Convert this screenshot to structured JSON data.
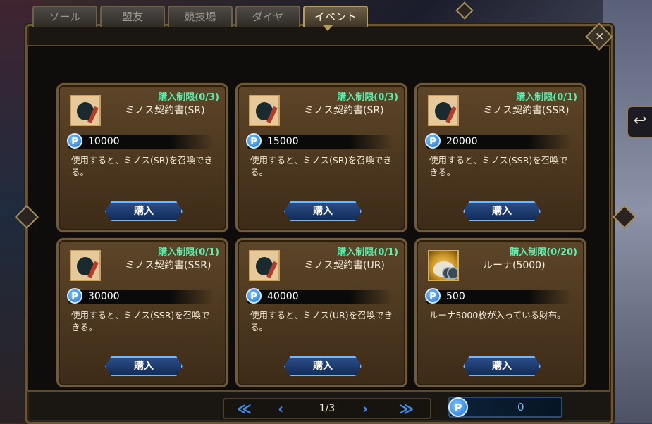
{
  "tabs": [
    "ソール",
    "盟友",
    "競技場",
    "ダイヤ",
    "イベント"
  ],
  "active_tab": "イベント",
  "close_symbol": "×",
  "return_symbol": "↩",
  "currency_symbol": "P",
  "items": [
    {
      "limit": "購入制限(0/3)",
      "name": "ミノス契約書(SR)",
      "price": "10000",
      "desc": "使用すると、ミノス(SR)を召喚できる。",
      "button": "購入",
      "icon": "scroll-icon"
    },
    {
      "limit": "購入制限(0/3)",
      "name": "ミノス契約書(SR)",
      "price": "15000",
      "desc": "使用すると、ミノス(SR)を召喚できる。",
      "button": "購入",
      "icon": "scroll-icon"
    },
    {
      "limit": "購入制限(0/1)",
      "name": "ミノス契約書(SSR)",
      "price": "20000",
      "desc": "使用すると、ミノス(SSR)を召喚できる。",
      "button": "購入",
      "icon": "scroll-icon"
    },
    {
      "limit": "購入制限(0/1)",
      "name": "ミノス契約書(SSR)",
      "price": "30000",
      "desc": "使用すると、ミノス(SSR)を召喚できる。",
      "button": "購入",
      "icon": "scroll-icon"
    },
    {
      "limit": "購入制限(0/1)",
      "name": "ミノス契約書(UR)",
      "price": "40000",
      "desc": "使用すると、ミノス(UR)を召喚できる。",
      "button": "購入",
      "icon": "scroll-icon"
    },
    {
      "limit": "購入制限(0/20)",
      "name": "ルーナ(5000)",
      "price": "500",
      "desc": "ルーナ5000枚が入っている財布。",
      "button": "購入",
      "icon": "coin-purse-icon"
    }
  ],
  "pager": {
    "first": "≪",
    "prev": "‹",
    "page": "1/3",
    "next": "›",
    "last": "≫"
  },
  "balance": "0"
}
